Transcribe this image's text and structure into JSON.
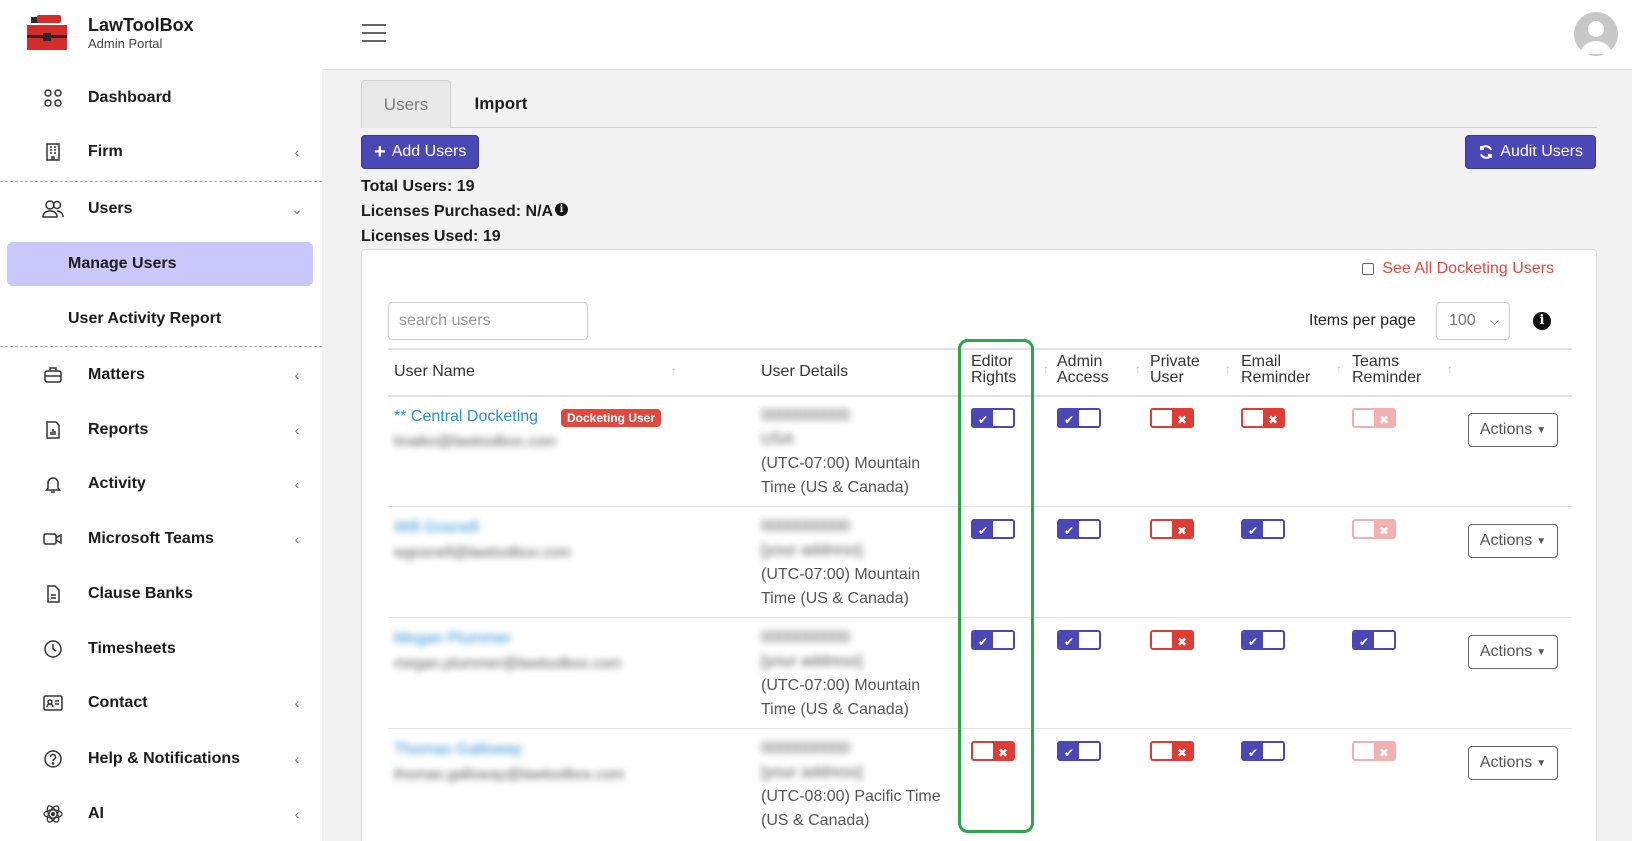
{
  "brand": {
    "title": "LawToolBox",
    "subtitle": "Admin Portal"
  },
  "sidebar": {
    "items": [
      {
        "label": "Dashboard",
        "icon": "grid-icon",
        "chevron": ""
      },
      {
        "label": "Firm",
        "icon": "building-icon",
        "chevron": "‹"
      },
      {
        "label": "Users",
        "icon": "users-icon",
        "chevron": "⌄"
      },
      {
        "label": "Matters",
        "icon": "briefcase-icon",
        "chevron": "‹"
      },
      {
        "label": "Reports",
        "icon": "report-icon",
        "chevron": "‹"
      },
      {
        "label": "Activity",
        "icon": "bell-icon",
        "chevron": "‹"
      },
      {
        "label": "Microsoft Teams",
        "icon": "video-icon",
        "chevron": "‹"
      },
      {
        "label": "Clause Banks",
        "icon": "document-icon",
        "chevron": ""
      },
      {
        "label": "Timesheets",
        "icon": "clock-icon",
        "chevron": ""
      },
      {
        "label": "Contact",
        "icon": "contact-card-icon",
        "chevron": "‹"
      },
      {
        "label": "Help & Notifications",
        "icon": "help-icon",
        "chevron": "‹"
      },
      {
        "label": "AI",
        "icon": "ai-icon",
        "chevron": "‹"
      }
    ],
    "sub_items": [
      {
        "label": "Manage Users",
        "active": true
      },
      {
        "label": "User Activity Report",
        "active": false
      }
    ]
  },
  "tabs": {
    "users": "Users",
    "import": "Import"
  },
  "toolbar": {
    "add_users": "Add Users",
    "audit_users": "Audit Users"
  },
  "stats": {
    "total_users": "Total Users: 19",
    "licenses_purchased": "Licenses Purchased: N/A",
    "licenses_used": "Licenses Used: 19",
    "info_glyph": "i"
  },
  "filters": {
    "see_all": "See All Docketing Users",
    "search_placeholder": "search users",
    "items_per_page_label": "Items per page",
    "items_per_page_value": "100"
  },
  "table": {
    "headers": {
      "user_name": "User Name",
      "user_details": "User Details",
      "editor_rights": [
        "Editor",
        "Rights"
      ],
      "admin_access": [
        "Admin",
        "Access"
      ],
      "private_user": [
        "Private",
        "User"
      ],
      "email_reminder": [
        "Email",
        "Reminder"
      ],
      "teams_reminder": [
        "Teams",
        "Reminder"
      ],
      "sort_glyph": "↑"
    },
    "actions_label": "Actions",
    "rows": [
      {
        "name": "** Central Docketing",
        "badge": "Docketing User",
        "email": "lmaiko@lawtoolbox.com",
        "phone": "0000000000",
        "address": "USA",
        "tz_line1": "(UTC-07:00) Mountain",
        "tz_line2": "Time (US & Canada)",
        "editor": "on",
        "admin": "on",
        "private": "off",
        "email_rem": "off",
        "teams": "off-faded"
      },
      {
        "name": "Will Gosnell",
        "badge": "",
        "email": "wgosnell@lawtoolbox.com",
        "phone": "0000000000",
        "address": "[your address]",
        "tz_line1": "(UTC-07:00) Mountain",
        "tz_line2": "Time (US & Canada)",
        "editor": "on",
        "admin": "on",
        "private": "off",
        "email_rem": "on",
        "teams": "off-faded"
      },
      {
        "name": "Megan Plummer",
        "badge": "",
        "email": "megan.plummer@lawtoolbox.com",
        "phone": "0000000000",
        "address": "[your address]",
        "tz_line1": "(UTC-07:00) Mountain",
        "tz_line2": "Time (US & Canada)",
        "editor": "on",
        "admin": "on",
        "private": "off",
        "email_rem": "on",
        "teams": "on"
      },
      {
        "name": "Thomas Galloway",
        "badge": "",
        "email": "thomas.galloway@lawtoolbox.com",
        "phone": "0000000000",
        "address": "[your address]",
        "tz_line1": "(UTC-08:00) Pacific Time",
        "tz_line2": "(US & Canada)",
        "editor": "off",
        "admin": "on",
        "private": "off",
        "email_rem": "on",
        "teams": "off-faded"
      }
    ]
  },
  "colors": {
    "primary": "#4b47b5",
    "danger": "#df3c36",
    "link": "#2b8ed6",
    "highlight": "#2ea44f",
    "active_nav": "#c9c7fb"
  }
}
